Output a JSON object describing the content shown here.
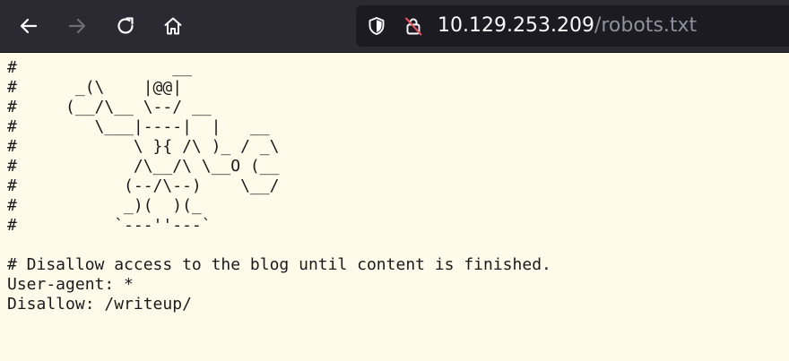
{
  "browser": {
    "url_host": "10.129.253.209",
    "url_path": "/robots.txt",
    "nav": {
      "back_icon": "back-arrow-icon",
      "forward_icon": "forward-arrow-icon",
      "reload_icon": "reload-icon",
      "home_icon": "home-icon"
    },
    "colors": {
      "toolbar": "#2b2a33",
      "url_bar": "#1c1b22",
      "page_background": "#fffbeb"
    }
  },
  "page": {
    "lines": [
      "#                __",
      "#      _(\\    |@@|",
      "#     (__/\\__ \\--/ __",
      "#        \\___|----|  |   __",
      "#            \\ }{ /\\ )_ / _\\",
      "#            /\\__/\\ \\__O (__",
      "#           (--/\\--)    \\__/",
      "#           _)(  )(_",
      "#          `---''---`",
      "",
      "# Disallow access to the blog until content is finished.",
      "User-agent: *",
      "Disallow: /writeup/"
    ]
  }
}
